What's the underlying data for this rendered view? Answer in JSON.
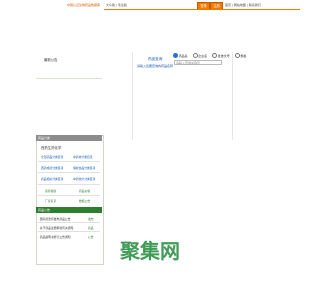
{
  "header": {
    "site_banner": "中国认证生物药品数据库",
    "top_links": "大众版 | 专业版",
    "login": "登录",
    "register": "注册",
    "right_links": "首页 | 网站地图 | 联系我们"
  },
  "left": {
    "top_label": "最新公告",
    "categories_header": "药品分类",
    "categories_title": "西药生药化学",
    "category_links": [
      [
        "全部药品分类目录",
        "中药材分类目录"
      ],
      [
        "西药成药分类目录",
        "保健食品分类目录"
      ],
      [
        "药品相关分类目录",
        "中药饮片分类目录"
      ]
    ],
    "extra_links": [
      [
        "营养健康",
        "药品价格"
      ],
      [
        "厂家名录",
        "数据公告"
      ]
    ],
    "notice_header": "药品公告",
    "notices": [
      {
        "text": "· 国家药监局发布药品公告",
        "tag": "发布"
      },
      {
        "text": "· 关于药品注册审批有关通知",
        "tag": "药品"
      },
      {
        "text": "· 药品说明书修订公告通知",
        "tag": "公告"
      }
    ]
  },
  "center": {
    "title": "药品查询",
    "subtitle": "请输入您要查询的药品名称",
    "radios": [
      {
        "label": "药品名",
        "on": true
      },
      {
        "label": "企业名",
        "on": false
      },
      {
        "label": "批准文号",
        "on": false
      },
      {
        "label": "规格",
        "on": false
      }
    ],
    "search_placeholder": "请输入查询关键字"
  },
  "watermark": "聚集网",
  "colors": {
    "brand_orange": "#f07a00",
    "link_blue": "#0a58b5",
    "notice_green": "#2f7d2f",
    "watermark_green": "#1f8a3a"
  }
}
